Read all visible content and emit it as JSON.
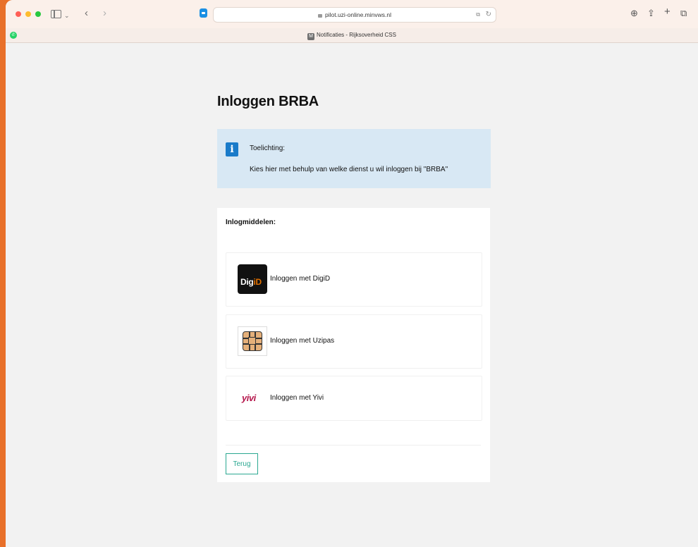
{
  "browser": {
    "url": "pilot.uzi-online.minvws.nl",
    "tab_title": "Notificaties - Rijksoverheid CSS",
    "favicon_letter": "M",
    "icons": {
      "back": "chevron-left",
      "forward": "chevron-right",
      "download": "download",
      "share": "share",
      "new_tab": "plus",
      "tab_overview": "tabs"
    }
  },
  "page": {
    "title": "Inloggen BRBA",
    "info": {
      "heading": "Toelichting:",
      "text": "Kies hier met behulp van welke dienst u wil inloggen bij \"BRBA\""
    },
    "panel": {
      "heading": "Inlogmiddelen:",
      "methods": [
        {
          "label": "Inloggen met DigiD",
          "logo_text_a": "Dig",
          "logo_text_b": "iD"
        },
        {
          "label": "Inloggen met Uzipas"
        },
        {
          "label": "Inloggen met Yivi",
          "logo_text": "yivi"
        }
      ],
      "back_label": "Terug"
    }
  },
  "colors": {
    "info_bg": "#d8e8f4",
    "info_icon": "#1a7bc9",
    "accent_green": "#2ba891",
    "digid_orange": "#e17000",
    "yivi_red": "#b5164b"
  }
}
